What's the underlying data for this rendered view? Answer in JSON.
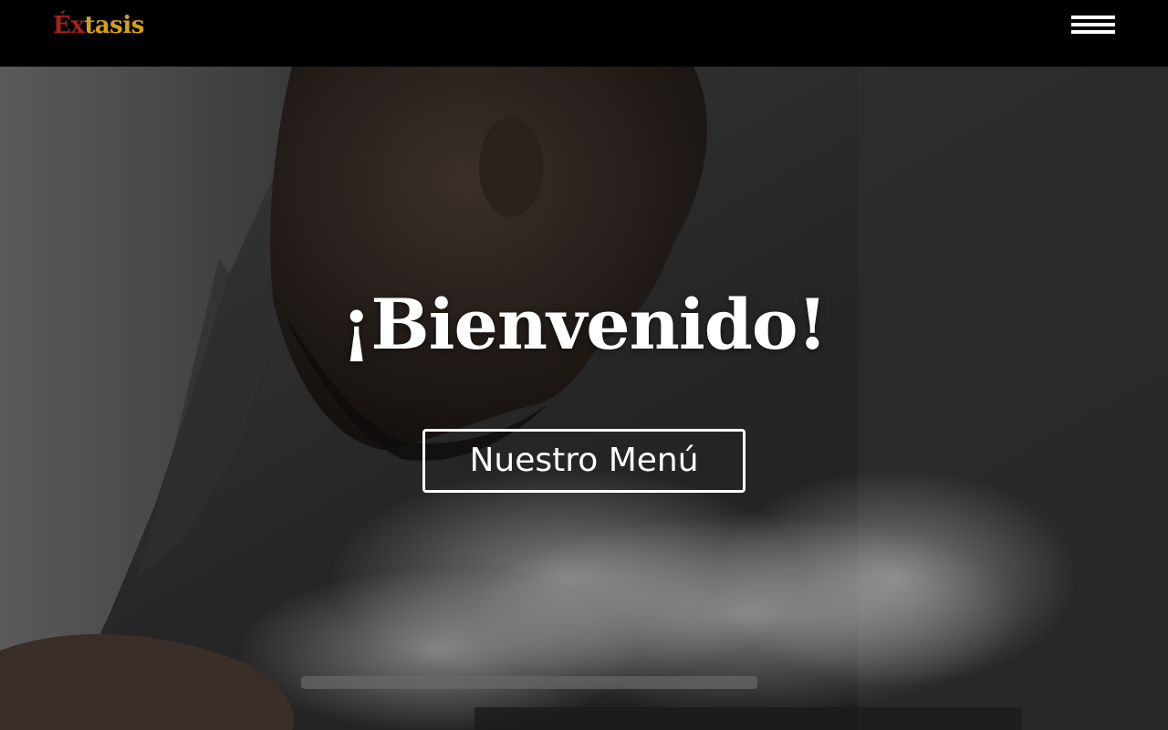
{
  "brand": {
    "logo_part_a": "Éx",
    "logo_part_b": "tasis",
    "color_a": "#a8201f",
    "color_b": "#d4a017"
  },
  "nav": {
    "menu_icon": "hamburger-menu-icon"
  },
  "hero": {
    "title": "¡Bienvenido!",
    "cta_label": "Nuestro Menú",
    "background_image": "chef-cooking-steam-photo"
  }
}
